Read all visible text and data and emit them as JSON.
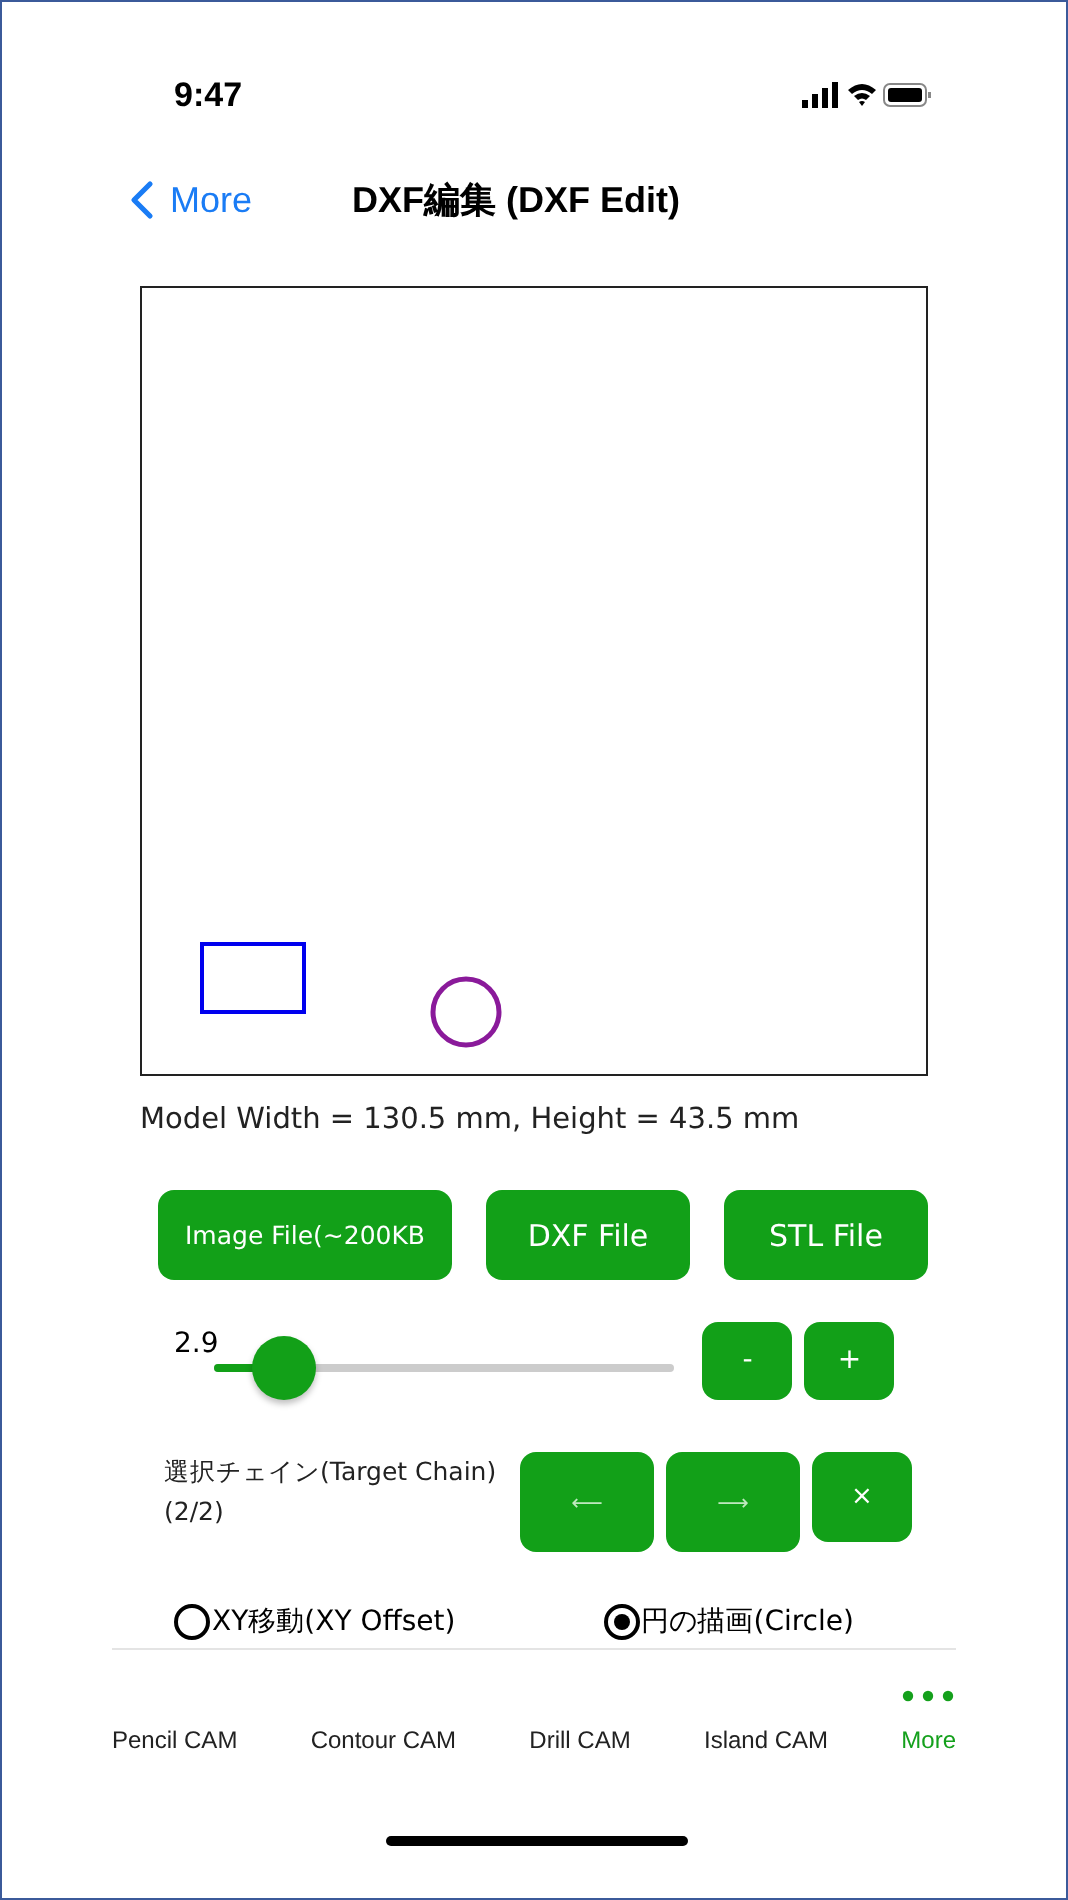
{
  "status_bar": {
    "time": "9:47"
  },
  "nav": {
    "back": "More",
    "title": "DXF編集 (DXF Edit)"
  },
  "canvas": {
    "shapes": [
      {
        "kind": "rectangle",
        "color": "#0000ee"
      },
      {
        "kind": "circle",
        "color": "#8a1a9a"
      }
    ]
  },
  "model_info": "Model Width = 130.5 mm, Height = 43.5 mm",
  "file_buttons": [
    "Image File(~200KB",
    "DXF File",
    "STL File"
  ],
  "slider": {
    "reading": "2.9",
    "level": 0.15,
    "buttons": [
      "-",
      "+"
    ]
  },
  "chain": {
    "label": "選択チェイン(Target Chain)",
    "count": "(2/2)",
    "buttons": [
      "⟵",
      "⟶",
      "×"
    ]
  },
  "modes": [
    {
      "label": "XY移動(XY Offset)",
      "selected": false
    },
    {
      "label": "円の描画(Circle)",
      "selected": true
    }
  ],
  "tab_bar": [
    {
      "label": "Pencil CAM",
      "selected": false
    },
    {
      "label": "Contour CAM",
      "selected": false
    },
    {
      "label": "Drill CAM",
      "selected": false
    },
    {
      "label": "Island CAM",
      "selected": false
    },
    {
      "label": "More",
      "selected": true
    }
  ]
}
